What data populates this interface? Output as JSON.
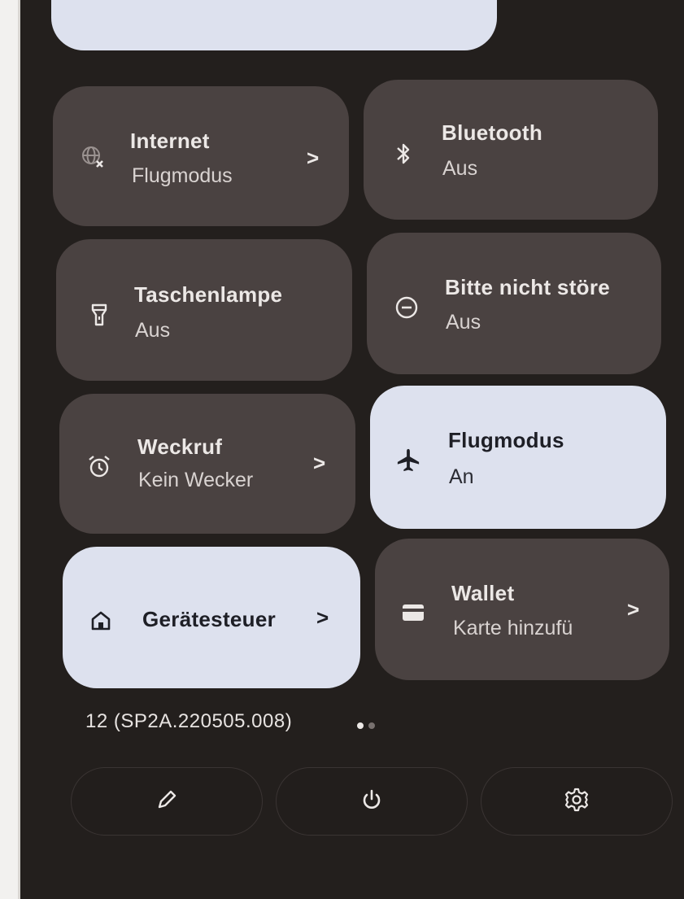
{
  "tiles": {
    "internet": {
      "title": "Internet",
      "sub": "Flugmodus",
      "icon": "globe-off-icon"
    },
    "bluetooth": {
      "title": "Bluetooth",
      "sub": "Aus",
      "icon": "bluetooth-icon"
    },
    "flashlight": {
      "title": "Taschenlampe",
      "sub": "Aus",
      "icon": "flashlight-icon"
    },
    "dnd": {
      "title": "Bitte nicht störe",
      "sub": "Aus",
      "icon": "do-not-disturb-icon"
    },
    "alarm": {
      "title": "Weckruf",
      "sub": "Kein Wecker",
      "icon": "alarm-clock-icon"
    },
    "airplane": {
      "title": "Flugmodus",
      "sub": "An",
      "icon": "airplane-icon"
    },
    "device_controls": {
      "title": "Gerätesteuer",
      "icon": "home-icon"
    },
    "wallet": {
      "title": "Wallet",
      "sub": "Karte hinzufü",
      "icon": "wallet-card-icon"
    }
  },
  "chevron": ">",
  "build": "12 (SP2A.220505.008)",
  "page_indicator": {
    "count": 2,
    "active": 1
  },
  "bottom_buttons": [
    "edit-pencil-icon",
    "power-icon",
    "settings-gear-icon"
  ],
  "colors": {
    "panel_bg": "#231f1d",
    "tile_off": "#4a4241",
    "tile_on": "#dde1ee",
    "text_light": "#ece8e6",
    "text_dark": "#1e1f26"
  }
}
